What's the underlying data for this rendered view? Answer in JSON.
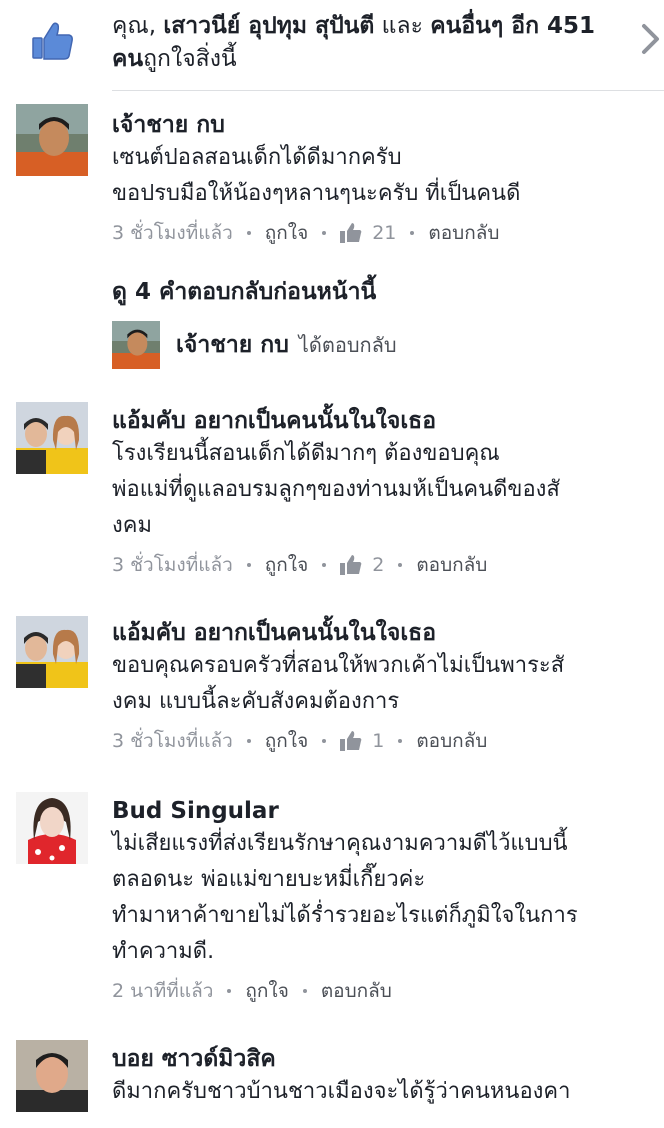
{
  "likes_summary": {
    "prefix": "คุณ,",
    "names": "เสาวนีย์ อุปทุม สุปันตี",
    "conj": "และ",
    "others": "คนอื่นๆ อีก 451",
    "others2": "คน",
    "suffix": "ถูกใจสิ่งนี้",
    "icon": "thumbs-up-icon",
    "accent": "#4267b2"
  },
  "comments": [
    {
      "author": "เจ้าชาย กบ",
      "lines": [
        "เซนต์ปอลสอนเด็กได้ดีมากครับ",
        "ขอปรบมือให้น้องๆหลานๆนะครับ ที่เป็นคนดี"
      ],
      "time": "3 ชั่วโมงที่แล้ว",
      "like_label": "ถูกใจ",
      "like_count": "21",
      "reply_label": "ตอบกลับ"
    },
    {
      "author": "แอ้มคับ อยากเป็นคนนั้นในใจเธอ",
      "lines": [
        "โรงเรียนนี้สอนเด็กได้ดีมากๆ ต้องขอบคุณ",
        "พ่อแม่ที่ดูแลอบรมลูกๆของท่านมห้เป็นคนดีของสั",
        "งคม"
      ],
      "time": "3 ชั่วโมงที่แล้ว",
      "like_label": "ถูกใจ",
      "like_count": "2",
      "reply_label": "ตอบกลับ"
    },
    {
      "author": "แอ้มคับ อยากเป็นคนนั้นในใจเธอ",
      "lines": [
        "ขอบคุณครอบครัวที่สอนให้พวกเค้าไม่เป็นพาระสั",
        "งคม แบบนี้ละคับสังคมต้องการ"
      ],
      "time": "3 ชั่วโมงที่แล้ว",
      "like_label": "ถูกใจ",
      "like_count": "1",
      "reply_label": "ตอบกลับ"
    },
    {
      "author": "Bud Singular",
      "lines": [
        "ไม่เสียแรงที่ส่งเรียนรักษาคุณงามความดีไว้แบบนี้",
        "ตลอดนะ พ่อแม่ขายบะหมี่เกี๊ยวค่ะ",
        "ทำมาหาค้าขายไม่ได้ร่ำรวยอะไรแต่ก็ภูมิใจในการ",
        "ทำความดี."
      ],
      "time": "2 นาทีที่แล้ว",
      "like_label": "ถูกใจ",
      "reply_label": "ตอบกลับ"
    },
    {
      "author": "บอย ซาวด์มิวสิค",
      "lines": [
        "ดีมากครับชาวบ้านชาวเมืองจะได้รู้ว่าคนหนองคา"
      ]
    }
  ],
  "replies_section": {
    "view_previous": "ดู 4 คำตอบกลับก่อนหน้านี้",
    "reply_author": "เจ้าชาย กบ",
    "reply_action": "ได้ตอบกลับ"
  }
}
